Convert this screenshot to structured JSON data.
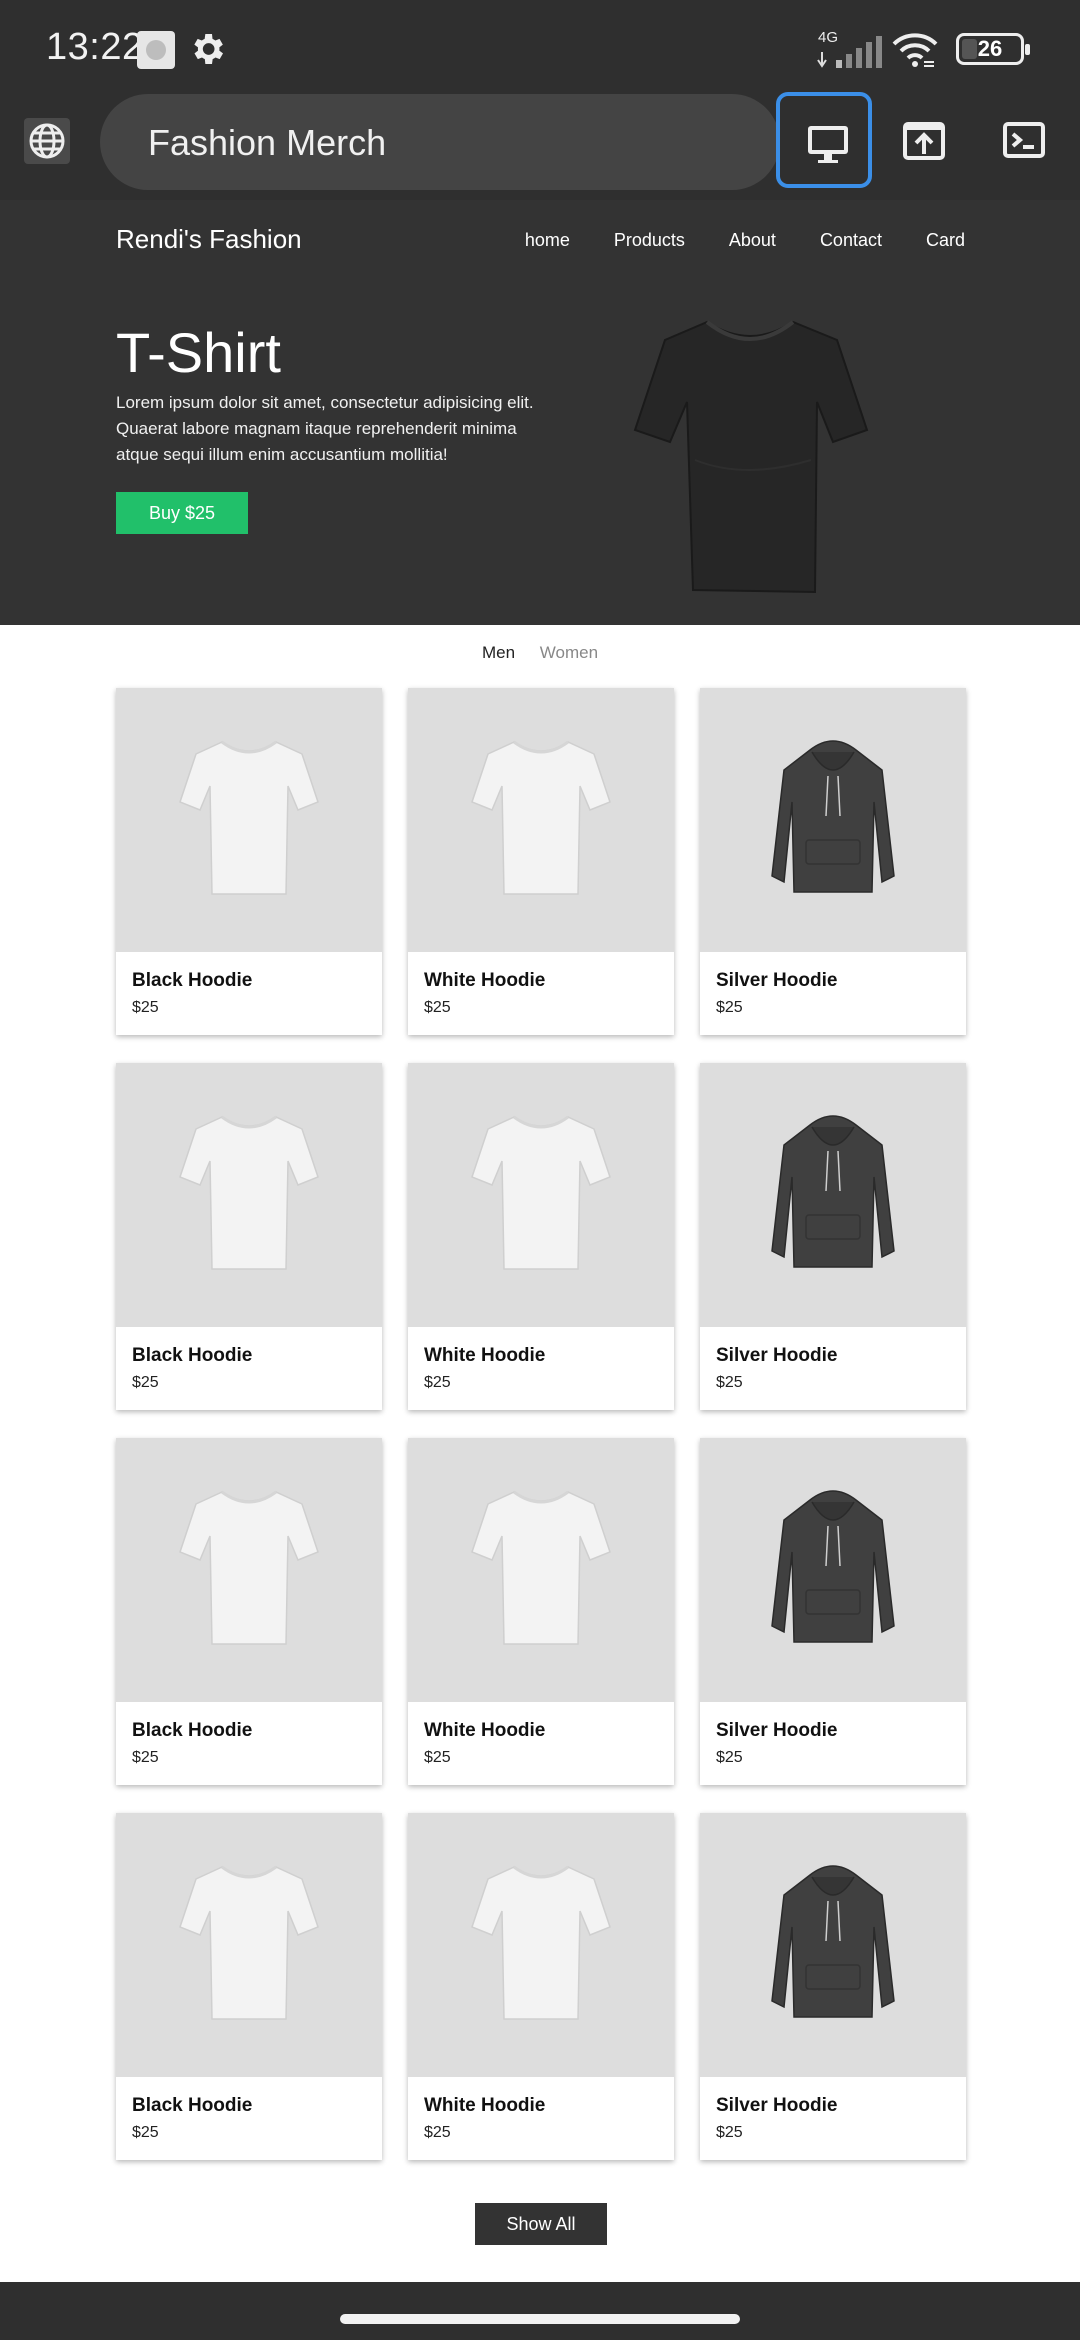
{
  "status_bar": {
    "time": "13:22",
    "network_label": "4G",
    "battery": "26",
    "battery_level": 0.26
  },
  "browser": {
    "url_text": "Fashion Merch",
    "buttons": [
      "desktop-view",
      "share",
      "terminal"
    ],
    "accent": "#3b8fe8"
  },
  "site": {
    "brand": "Rendi's Fashion",
    "nav": [
      "home",
      "Products",
      "About",
      "Contact",
      "Card"
    ],
    "hero": {
      "title": "T-Shirt",
      "text": "Lorem ipsum dolor sit amet, consectetur adipisicing elit. Quaerat labore magnam itaque reprehenderit minima atque sequi illum enim accusantium mollitia!",
      "buy_label": "Buy $25",
      "buy_color": "#21c06a"
    },
    "tabs": [
      "Men",
      "Women"
    ],
    "products": [
      {
        "name": "Black Hoodie",
        "price": "$25",
        "image": "white-tshirt"
      },
      {
        "name": "White Hoodie",
        "price": "$25",
        "image": "white-tshirt"
      },
      {
        "name": "Silver Hoodie",
        "price": "$25",
        "image": "dark-hoodie"
      },
      {
        "name": "Black Hoodie",
        "price": "$25",
        "image": "white-tshirt"
      },
      {
        "name": "White Hoodie",
        "price": "$25",
        "image": "white-tshirt"
      },
      {
        "name": "Silver Hoodie",
        "price": "$25",
        "image": "dark-hoodie"
      },
      {
        "name": "Black Hoodie",
        "price": "$25",
        "image": "white-tshirt"
      },
      {
        "name": "White Hoodie",
        "price": "$25",
        "image": "white-tshirt"
      },
      {
        "name": "Silver Hoodie",
        "price": "$25",
        "image": "dark-hoodie"
      },
      {
        "name": "Black Hoodie",
        "price": "$25",
        "image": "white-tshirt"
      },
      {
        "name": "White Hoodie",
        "price": "$25",
        "image": "white-tshirt"
      },
      {
        "name": "Silver Hoodie",
        "price": "$25",
        "image": "dark-hoodie"
      }
    ],
    "show_all_label": "Show All"
  }
}
